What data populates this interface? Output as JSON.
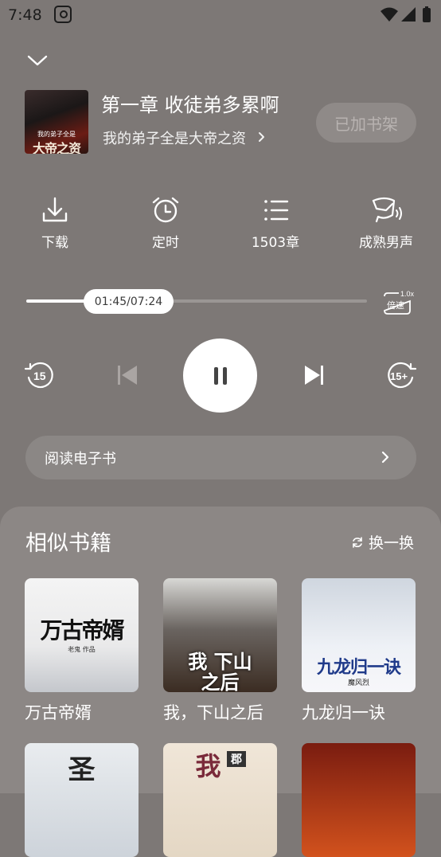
{
  "status_bar": {
    "time": "7:48"
  },
  "player": {
    "chapter_title": "第一章 收徒弟多累啊",
    "book_title": "我的弟子全是大帝之资",
    "cover_line1": "我的弟子全是",
    "cover_line2": "大帝之资",
    "shelf_button": "已加书架",
    "actions": {
      "download": "下载",
      "timer": "定时",
      "chapters": "1503章",
      "voice": "成熟男声"
    },
    "progress": {
      "time_label": "01:45/07:24",
      "fraction": 0.236
    },
    "speed": {
      "value": "1.0x",
      "label": "倍速"
    },
    "rewind_label": "15",
    "forward_label": "15+",
    "read_ebook": "阅读电子书"
  },
  "similar": {
    "title": "相似书籍",
    "refresh": "换一换",
    "books": [
      {
        "name": "万古帝婿",
        "cover_text": "万古帝婿",
        "author": "老鬼 作品"
      },
      {
        "name": "我，下山之后",
        "cover_text": "我 下山之后"
      },
      {
        "name": "九龙归一诀",
        "cover_text": "九龙归一诀",
        "author": "魔风烈"
      }
    ],
    "partial_covers": [
      "圣",
      "我",
      "郡"
    ]
  }
}
